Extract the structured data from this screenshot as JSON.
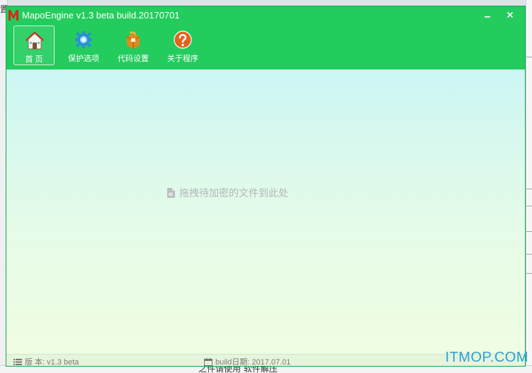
{
  "window": {
    "title": "MapoEngine v1.3 beta build.20170701",
    "minimize_glyph": "—",
    "close_glyph": "✕"
  },
  "toolbar": {
    "items": [
      {
        "label": "首 页",
        "icon": "home-icon",
        "active": true
      },
      {
        "label": "保护选项",
        "icon": "gear-icon",
        "active": false
      },
      {
        "label": "代码设置",
        "icon": "code-box-icon",
        "active": false
      },
      {
        "label": "关于程序",
        "icon": "question-icon",
        "active": false
      }
    ]
  },
  "main": {
    "drop_hint": "拖拽待加密的文件到此处"
  },
  "status": {
    "version_label": "版 本: v1.3 beta",
    "build_label": "build日期: 2017.07.01"
  },
  "background": {
    "left_glyph": "置",
    "bottom_text": "之件请使用        软件解压"
  },
  "watermark": "ITMOP.COM",
  "colors": {
    "title_green": "#23cc5d",
    "content_top": "#ccf6f4",
    "content_bottom": "#effde3",
    "watermark_blue": "#2f9fd6"
  }
}
